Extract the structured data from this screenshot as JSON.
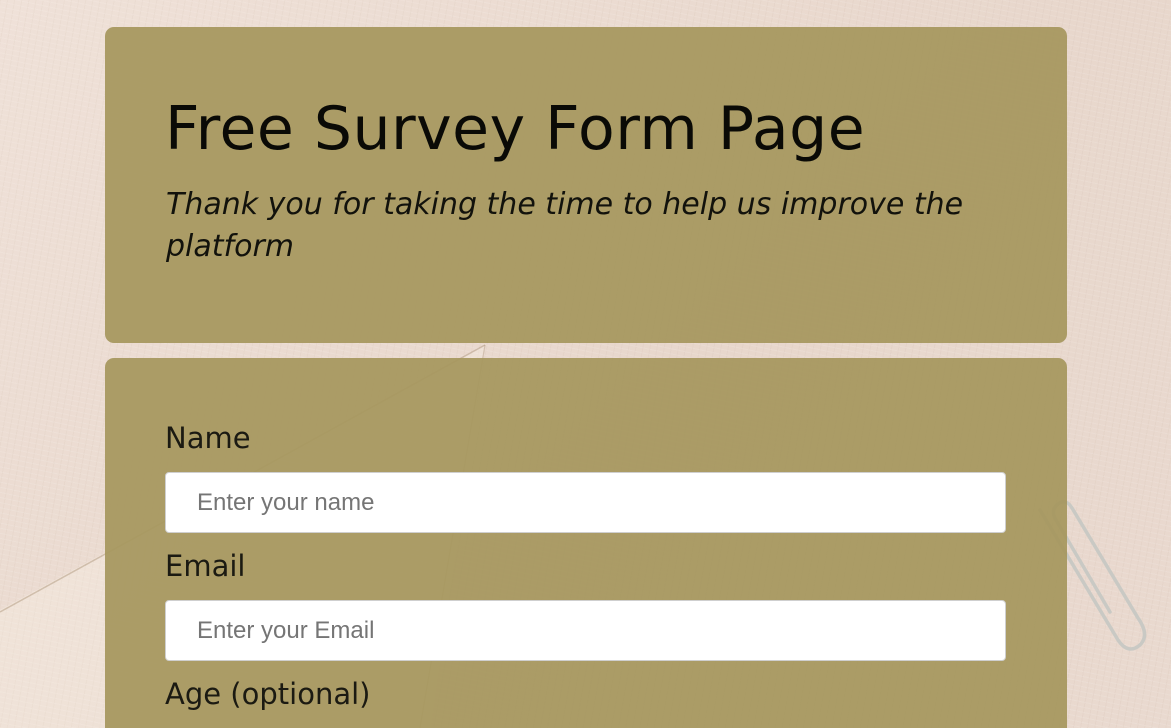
{
  "header": {
    "title": "Free Survey Form Page",
    "description": "Thank you for taking the time to help us improve the platform"
  },
  "form": {
    "fields": [
      {
        "label": "Name",
        "placeholder": "Enter your name"
      },
      {
        "label": "Email",
        "placeholder": "Enter your Email"
      },
      {
        "label": "Age (optional)"
      }
    ]
  },
  "colors": {
    "card_background": "#a6975e",
    "page_background": "#ecdcd3",
    "input_background": "#ffffff"
  }
}
